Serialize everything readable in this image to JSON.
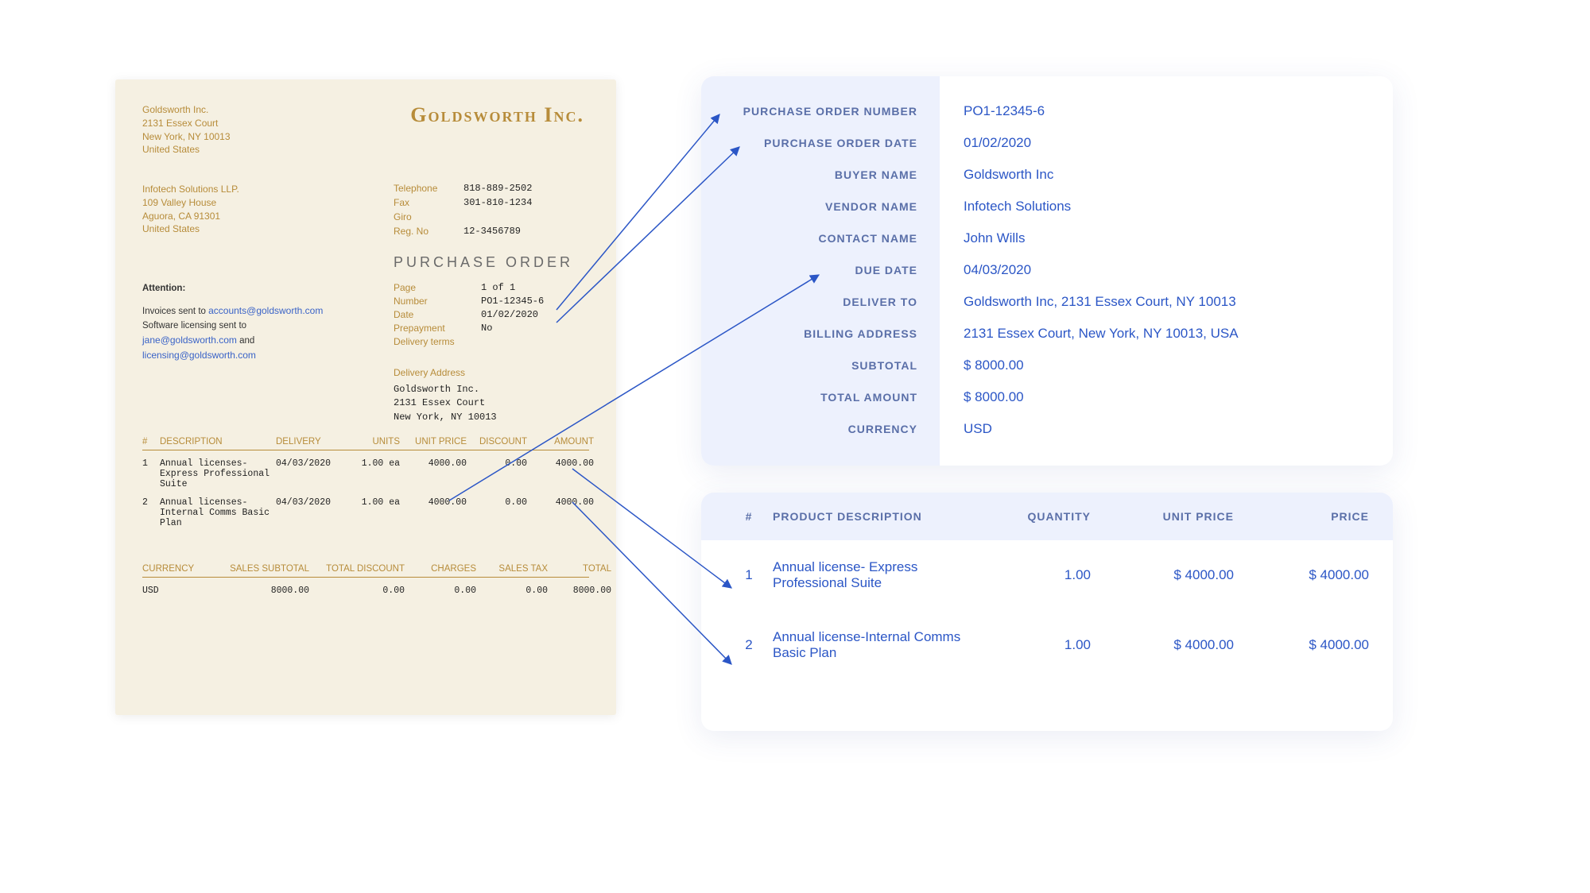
{
  "po": {
    "company_title": "Goldsworth Inc.",
    "buyer": {
      "name": "Goldsworth Inc.",
      "addr1": "2131 Essex Court",
      "addr2": "New York, NY 10013",
      "country": "United States"
    },
    "vendor": {
      "name": "Infotech Solutions LLP.",
      "addr1": "109 Valley House",
      "addr2": "Aguora, CA 91301",
      "country": "United States"
    },
    "contact": {
      "tel_lbl": "Telephone",
      "tel": "818-889-2502",
      "fax_lbl": "Fax",
      "fax": "301-810-1234",
      "giro_lbl": "Giro",
      "giro": "",
      "reg_lbl": "Reg. No",
      "reg": "12-3456789"
    },
    "heading": "PURCHASE ORDER",
    "meta": {
      "page_lbl": "Page",
      "page": "1 of 1",
      "number_lbl": "Number",
      "number": "PO1-12345-6",
      "date_lbl": "Date",
      "date": "01/02/2020",
      "prepay_lbl": "Prepayment",
      "prepay": "No",
      "terms_lbl": "Delivery terms"
    },
    "attention": {
      "hdr": "Attention:",
      "l1a": "Invoices sent to ",
      "l1b": "accounts@goldsworth.com",
      "l2": "Software licensing sent to",
      "l3a": "jane@goldsworth.com",
      "l3b": " and",
      "l4": "licensing@goldsworth.com"
    },
    "delivery": {
      "hdr": "Delivery Address",
      "l1": "Goldsworth Inc.",
      "l2": "2131 Essex Court",
      "l3": "New York, NY 10013"
    },
    "cols": {
      "num": "#",
      "desc": "DESCRIPTION",
      "deliv": "DELIVERY",
      "units": "UNITS",
      "uprice": "UNIT PRICE",
      "disc": "DISCOUNT",
      "amt": "AMOUNT"
    },
    "items": [
      {
        "n": "1",
        "desc": "Annual licenses- Express Professional Suite",
        "deliv": "04/03/2020",
        "units": "1.00 ea",
        "uprice": "4000.00",
        "disc": "0.00",
        "amt": "4000.00"
      },
      {
        "n": "2",
        "desc": "Annual licenses- Internal Comms Basic Plan",
        "deliv": "04/03/2020",
        "units": "1.00 ea",
        "uprice": "4000.00",
        "disc": "0.00",
        "amt": "4000.00"
      }
    ],
    "totals_cols": {
      "cur": "CURRENCY",
      "sub": "SALES SUBTOTAL",
      "disc": "TOTAL DISCOUNT",
      "chg": "CHARGES",
      "tax": "SALES TAX",
      "tot": "TOTAL"
    },
    "totals": {
      "cur": "USD",
      "sub": "8000.00",
      "disc": "0.00",
      "chg": "0.00",
      "tax": "0.00",
      "tot": "8000.00"
    }
  },
  "extracted": {
    "labels": {
      "po_number": "PURCHASE ORDER NUMBER",
      "po_date": "PURCHASE ORDER DATE",
      "buyer": "BUYER NAME",
      "vendor": "VENDOR NAME",
      "contact": "CONTACT NAME",
      "due": "DUE DATE",
      "deliver_to": "DELIVER TO",
      "billing": "BILLING ADDRESS",
      "subtotal": "SUBTOTAL",
      "total": "TOTAL AMOUNT",
      "currency": "CURRENCY"
    },
    "values": {
      "po_number": "PO1-12345-6",
      "po_date": "01/02/2020",
      "buyer": "Goldsworth Inc",
      "vendor": "Infotech Solutions",
      "contact": "John Wills",
      "due": "04/03/2020",
      "deliver_to": "Goldsworth Inc, 2131 Essex Court, NY 10013",
      "billing": "2131 Essex Court, New York, NY 10013, USA",
      "subtotal": "$ 8000.00",
      "total": "$ 8000.00",
      "currency": "USD"
    },
    "lines_cols": {
      "num": "#",
      "desc": "PRODUCT DESCRIPTION",
      "qty": "QUANTITY",
      "uprice": "UNIT PRICE",
      "price": "PRICE"
    },
    "lines": [
      {
        "n": "1",
        "desc": "Annual license- Express Professional Suite",
        "qty": "1.00",
        "uprice": "$ 4000.00",
        "price": "$ 4000.00"
      },
      {
        "n": "2",
        "desc": "Annual license-Internal Comms Basic Plan",
        "qty": "1.00",
        "uprice": "$ 4000.00",
        "price": "$ 4000.00"
      }
    ]
  }
}
